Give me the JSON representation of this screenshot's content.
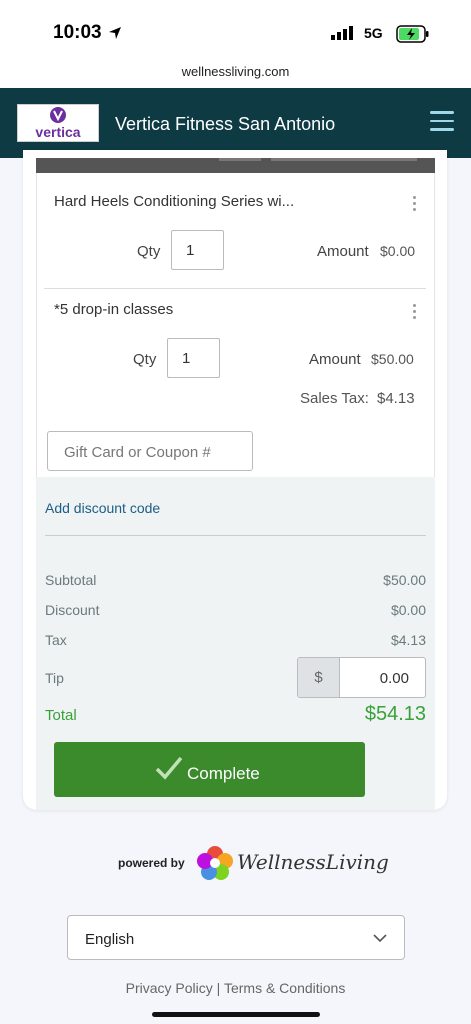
{
  "status": {
    "time": "10:03",
    "network": "5G"
  },
  "browser": {
    "url": "wellnessliving.com"
  },
  "header": {
    "logo_text": "vertica",
    "business_name": "Vertica Fitness San Antonio"
  },
  "cart": {
    "items": [
      {
        "title": "Hard Heels Conditioning Series wi...",
        "qty_label": "Qty",
        "qty": "1",
        "amount_label": "Amount",
        "amount": "$0.00"
      },
      {
        "title": "*5 drop-in classes",
        "qty_label": "Qty",
        "qty": "1",
        "amount_label": "Amount",
        "amount": "$50.00",
        "tax_label": "Sales Tax:",
        "tax": "$4.13"
      }
    ],
    "coupon_placeholder": "Gift Card or Coupon #"
  },
  "summary": {
    "discount_link": "Add discount code",
    "subtotal_label": "Subtotal",
    "subtotal": "$50.00",
    "discount_label": "Discount",
    "discount": "$0.00",
    "tax_label": "Tax",
    "tax": "$4.13",
    "tip_label": "Tip",
    "tip_currency": "$",
    "tip_value": "0.00",
    "total_label": "Total",
    "total": "$54.13",
    "complete_label": "Complete"
  },
  "footer": {
    "powered_by": "powered by",
    "brand": "WellnessLiving",
    "language": "English",
    "privacy": "Privacy Policy",
    "separator": "|",
    "terms": "Terms & Conditions"
  },
  "colors": {
    "header_bg": "#0e3a44",
    "accent_green": "#3b8a2c",
    "total_green": "#3aa13a",
    "link_blue": "#1d5e86"
  }
}
